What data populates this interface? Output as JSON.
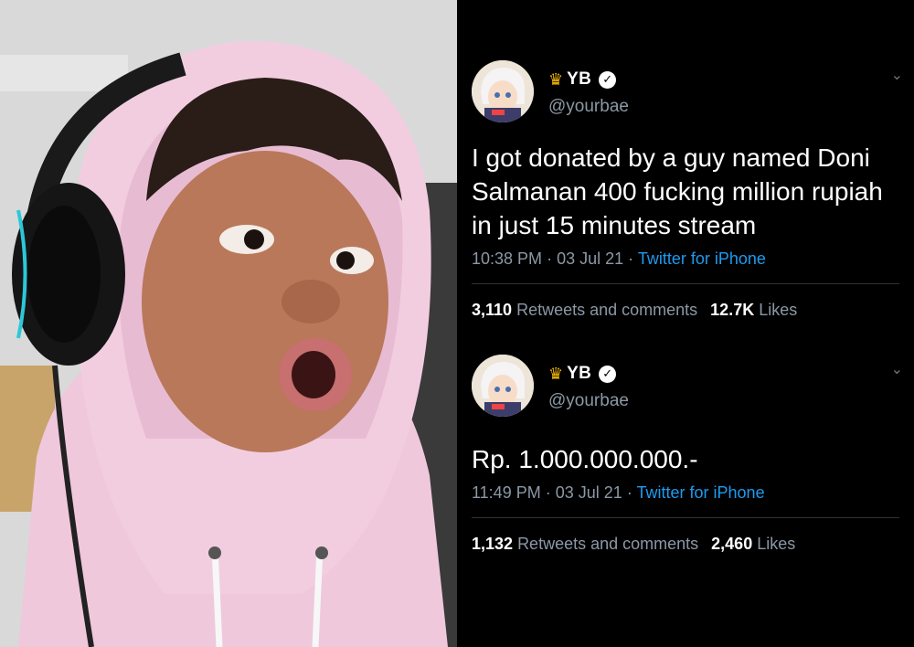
{
  "tweets": [
    {
      "display_name": "YB",
      "crown_icon": "crown-icon",
      "verified_icon": "verified-badge-icon",
      "handle": "@yourbae",
      "text": "I got donated by a guy named Doni Salmanan 400 fucking million rupiah in just 15 minutes stream",
      "time": "10:38 PM",
      "date": "03 Jul 21",
      "source": "Twitter for iPhone",
      "retweets_count": "3,110",
      "retweets_label": "Retweets and comments",
      "likes_count": "12.7K",
      "likes_label": "Likes"
    },
    {
      "display_name": "YB",
      "crown_icon": "crown-icon",
      "verified_icon": "verified-badge-icon",
      "handle": "@yourbae",
      "text": "Rp. 1.000.000.000.-",
      "time": "11:49 PM",
      "date": "03 Jul 21",
      "source": "Twitter for iPhone",
      "retweets_count": "1,132",
      "retweets_label": "Retweets and comments",
      "likes_count": "2,460",
      "likes_label": "Likes"
    }
  ],
  "separator": "·",
  "colors": {
    "background": "#000000",
    "muted_text": "#8b98a5",
    "link": "#1d9bf0",
    "hoodie": "#efc8dc"
  }
}
